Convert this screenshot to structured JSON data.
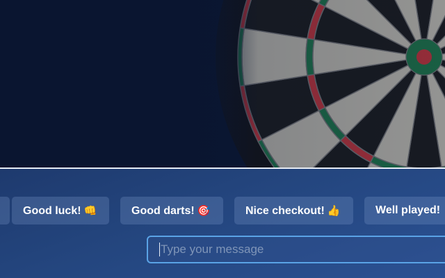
{
  "video": {
    "board_colors": {
      "dark": "#1c1c1c",
      "light": "#c9c5b8",
      "red": "#c8363c",
      "green": "#1f7a4a"
    }
  },
  "chat": {
    "quick_messages": [
      {
        "label": "Good luck!",
        "icon": "fist-bump-icon",
        "emoji": "👊"
      },
      {
        "label": "Good darts!",
        "icon": "dart-target-icon",
        "emoji": "🎯"
      },
      {
        "label": "Nice checkout!",
        "icon": "thumbs-up-icon",
        "emoji": "👍"
      },
      {
        "label": "Well played!",
        "icon": "",
        "emoji": ""
      }
    ],
    "input": {
      "placeholder": "Type your message",
      "value": ""
    }
  },
  "colors": {
    "panel_top": "#1e3a6e",
    "panel_bottom": "#2b5193",
    "input_border": "#5aa3e6",
    "chip_text": "#ffffff"
  }
}
